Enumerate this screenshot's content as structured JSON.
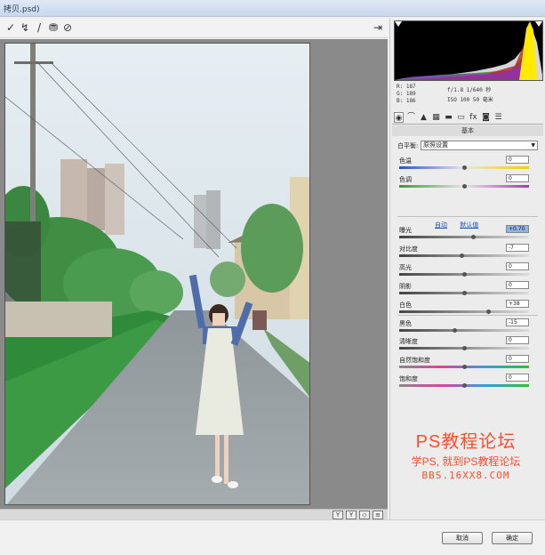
{
  "window": {
    "title": "拷贝.psd)"
  },
  "toolbar": {
    "tools": [
      {
        "icon": "white-balance-tool-icon",
        "glyph": "✓"
      },
      {
        "icon": "targeted-adjustment-icon",
        "glyph": "↯"
      },
      {
        "icon": "brush-icon",
        "glyph": "/"
      },
      {
        "icon": "straighten-icon",
        "glyph": "⛃"
      },
      {
        "icon": "rotate-icon",
        "glyph": "⊘"
      }
    ],
    "right_icon": "export-icon"
  },
  "histogram_readout": {
    "r": "R: 187",
    "g": "G: 189",
    "b": "B: 186",
    "aperture_shutter": "f/1.8   1/640 秒",
    "iso_focal": "ISO 100   50 毫米"
  },
  "panel": {
    "section_title": "基本",
    "white_balance": {
      "label": "白平衡:",
      "value": "原照设置"
    },
    "links": {
      "auto": "自动",
      "default": "默认值"
    },
    "sliders": [
      {
        "key": "temperature",
        "label": "色温",
        "value": "0",
        "position": 0.5,
        "track": "temp"
      },
      {
        "key": "tint",
        "label": "色调",
        "value": "0",
        "position": 0.5,
        "track": "tint"
      },
      {
        "key": "exposure",
        "label": "曝光",
        "value": "+0.70",
        "position": 0.57,
        "track": "gray",
        "selected": true
      },
      {
        "key": "contrast",
        "label": "对比度",
        "value": "-7",
        "position": 0.48,
        "track": "gray"
      },
      {
        "key": "highlights",
        "label": "高光",
        "value": "0",
        "position": 0.5,
        "track": "gray"
      },
      {
        "key": "shadows",
        "label": "阴影",
        "value": "0",
        "position": 0.5,
        "track": "gray"
      },
      {
        "key": "whites",
        "label": "白色",
        "value": "+38",
        "position": 0.69,
        "track": "gray"
      },
      {
        "key": "blacks",
        "label": "黑色",
        "value": "-15",
        "position": 0.43,
        "track": "gray"
      },
      {
        "key": "clarity",
        "label": "清晰度",
        "value": "0",
        "position": 0.5,
        "track": "gray"
      },
      {
        "key": "vibrance",
        "label": "自然饱和度",
        "value": "0",
        "position": 0.5,
        "track": "sat"
      },
      {
        "key": "saturation",
        "label": "饱和度",
        "value": "0",
        "position": 0.5,
        "track": "sat"
      }
    ]
  },
  "watermark": {
    "line1": "PS教程论坛",
    "line2": "学PS, 就到PS教程论坛",
    "line3": "BBS.16XX8.COM"
  },
  "buttons": {
    "cancel": "取消",
    "ok": "确定"
  },
  "colors": {
    "accent": "#1b4fb8",
    "watermark": "#ff4d2a"
  }
}
